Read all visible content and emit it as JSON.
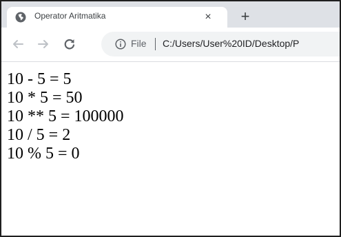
{
  "tab": {
    "title": "Operator Aritmatika",
    "favicon": "globe-icon",
    "close_symbol": "×"
  },
  "new_tab_symbol": "+",
  "toolbar": {
    "back_icon": "back-arrow-icon",
    "forward_icon": "forward-arrow-icon",
    "reload_icon": "reload-icon",
    "site_info_icon": "info-icon",
    "file_label": "File",
    "url": "C:/Users/User%20ID/Desktop/P"
  },
  "content": {
    "lines": [
      "10 - 5 = 5",
      "10 * 5 = 50",
      "10 ** 5 = 100000",
      "10 / 5 = 2",
      "10 % 5 = 0"
    ]
  },
  "colors": {
    "tabstrip_bg": "#dee1e6",
    "omnibox_bg": "#f1f3f4",
    "icon_gray": "#5f6368",
    "disabled_gray": "#bdc1c6"
  }
}
